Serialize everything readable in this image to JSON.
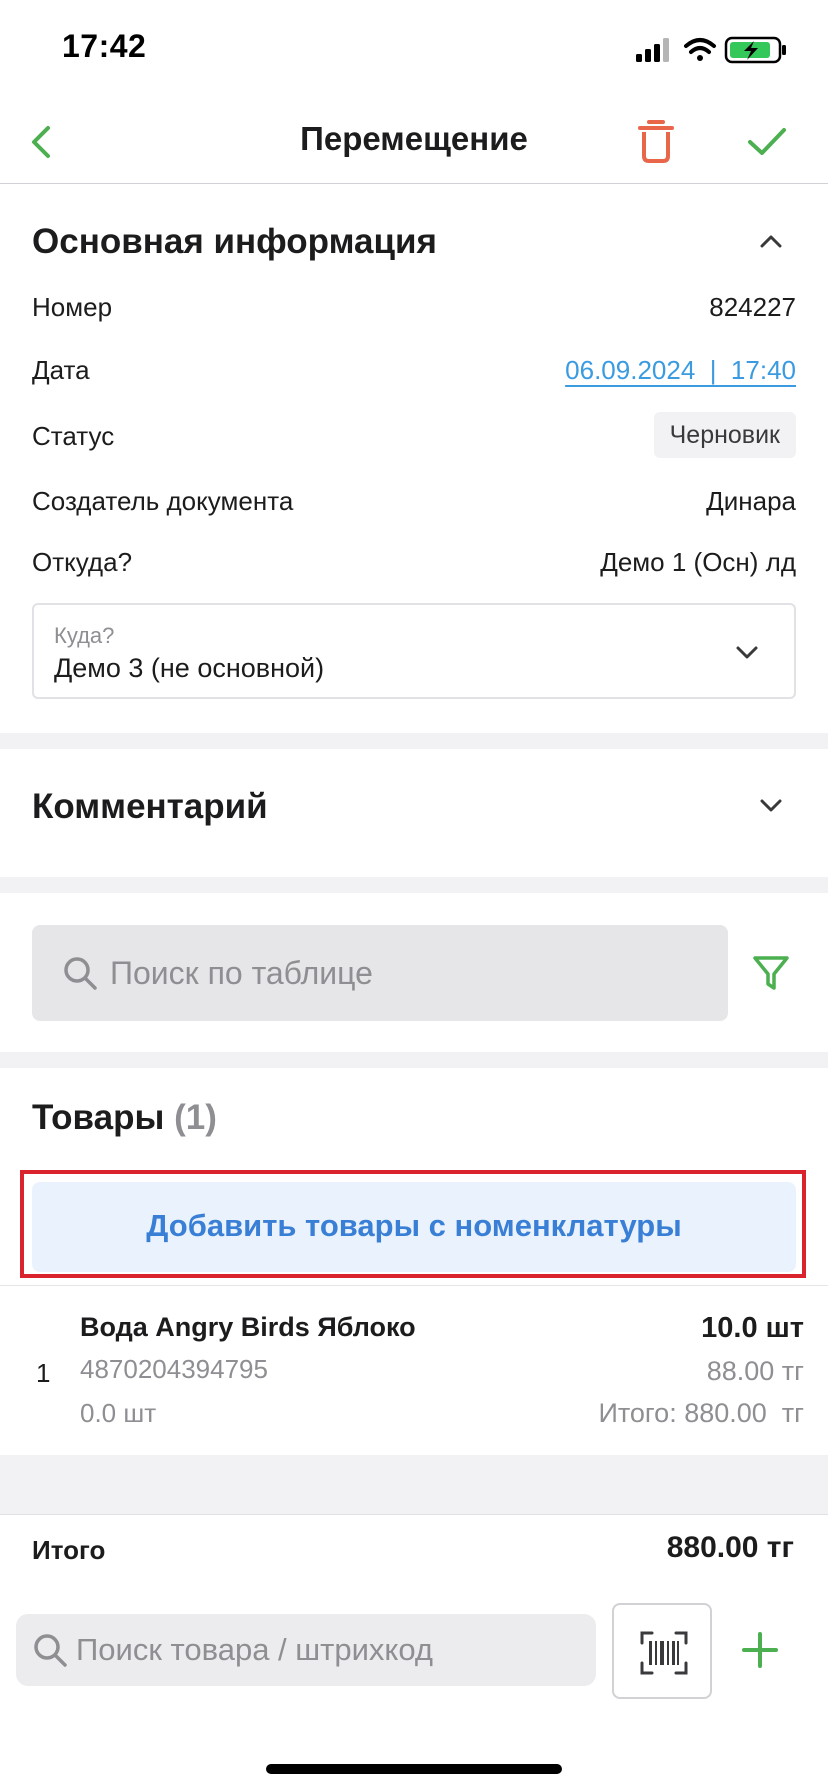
{
  "status_bar": {
    "time": "17:42"
  },
  "nav": {
    "title": "Перемещение",
    "back_icon": "chevron-left-icon",
    "delete_icon": "trash-icon",
    "confirm_icon": "checkmark-icon"
  },
  "main_info": {
    "title": "Основная информация",
    "rows": {
      "number": {
        "label": "Номер",
        "value": "824227"
      },
      "date": {
        "label": "Дата",
        "value": "06.09.2024  |  17:40"
      },
      "status": {
        "label": "Статус",
        "value": "Черновик"
      },
      "creator": {
        "label": "Создатель документа",
        "value": "Динара"
      },
      "from": {
        "label": "Откуда?",
        "value": "Демо 1 (Осн) лд"
      }
    },
    "to_field": {
      "label": "Куда?",
      "value": "Демо 3 (не основной)"
    }
  },
  "comment": {
    "title": "Комментарий"
  },
  "table_search": {
    "placeholder": "Поиск по таблице",
    "filter_icon": "filter-icon"
  },
  "goods": {
    "title": "Товары",
    "count": "(1)",
    "add_button": "Добавить товары с номенклатуры",
    "items": [
      {
        "index": "1",
        "name": "Вода Angry Birds Яблоко",
        "barcode": "4870204394795",
        "stock": "0.0 шт",
        "quantity": "10.0 шт",
        "price": "88.00 тг",
        "total": "Итого: 880.00  тг"
      }
    ]
  },
  "totals": {
    "label": "Итого",
    "value": "880.00 тг"
  },
  "bottom_bar": {
    "search_placeholder": "Поиск товара / штрихкод",
    "barcode_icon": "barcode-scan-icon",
    "add_icon": "plus-icon"
  },
  "colors": {
    "accent_green": "#4caf50",
    "delete_red": "#e8674a",
    "link_blue": "#3a9be0",
    "button_blue": "#3a7fd6",
    "highlight_red": "#d9232d"
  }
}
